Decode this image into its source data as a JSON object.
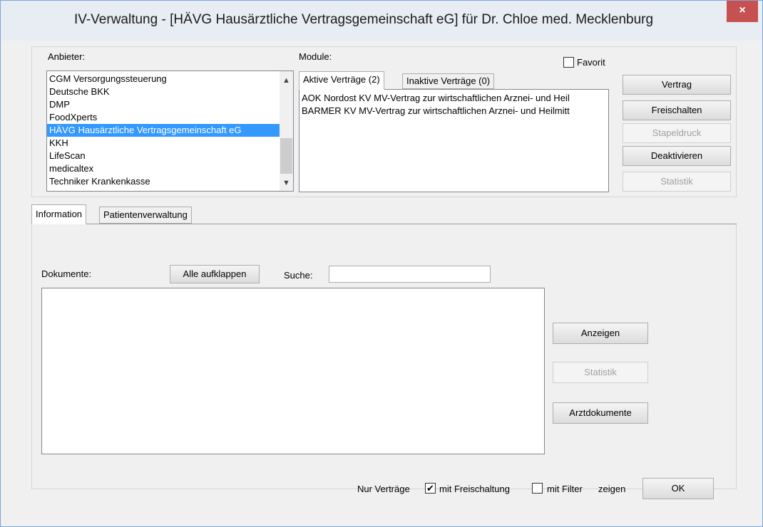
{
  "window": {
    "title": "IV-Verwaltung - [HÄVG Hausärztliche Vertragsgemeinschaft eG] für Dr. Chloe med. Mecklenburg",
    "close_glyph": "×"
  },
  "anbieter": {
    "label": "Anbieter:",
    "items": [
      {
        "label": "CGM Versorgungssteuerung",
        "selected": false
      },
      {
        "label": "Deutsche BKK",
        "selected": false
      },
      {
        "label": "DMP",
        "selected": false
      },
      {
        "label": "FoodXperts",
        "selected": false
      },
      {
        "label": "HÄVG Hausärztliche Vertragsgemeinschaft eG",
        "selected": true
      },
      {
        "label": "KKH",
        "selected": false
      },
      {
        "label": "LifeScan",
        "selected": false
      },
      {
        "label": "medicaltex",
        "selected": false
      },
      {
        "label": "Techniker Krankenkasse",
        "selected": false
      }
    ]
  },
  "module": {
    "label": "Module:",
    "favorit_label": "Favorit",
    "favorit_checked": false,
    "tabs": [
      {
        "label": "Aktive Verträge (2)",
        "active": true
      },
      {
        "label": "Inaktive Verträge (0)",
        "active": false
      }
    ],
    "contracts": [
      "AOK Nordost KV MV-Vertrag zur wirtschaftlichen Arznei- und Heil",
      "BARMER KV MV-Vertrag zur wirtschaftlichen Arznei- und Heilmitt"
    ]
  },
  "side_buttons": {
    "vertrag": "Vertrag",
    "freischalten": "Freischalten",
    "stapeldruck": "Stapeldruck",
    "deaktivieren": "Deaktivieren",
    "statistik": "Statistik"
  },
  "lower_tabs": [
    {
      "label": "Information",
      "active": true
    },
    {
      "label": "Patientenverwaltung",
      "active": false
    }
  ],
  "documents": {
    "label": "Dokumente:",
    "expand_all": "Alle aufklappen",
    "search_label": "Suche:",
    "search_value": "",
    "anzeigen": "Anzeigen",
    "statistik": "Statistik",
    "arztdokumente": "Arztdokumente"
  },
  "footer": {
    "nur_vertraege": "Nur Verträge",
    "mit_freischaltung": "mit Freischaltung",
    "mit_freischaltung_checked": true,
    "mit_filter": "mit Filter",
    "mit_filter_checked": false,
    "zeigen": "zeigen",
    "ok": "OK"
  }
}
